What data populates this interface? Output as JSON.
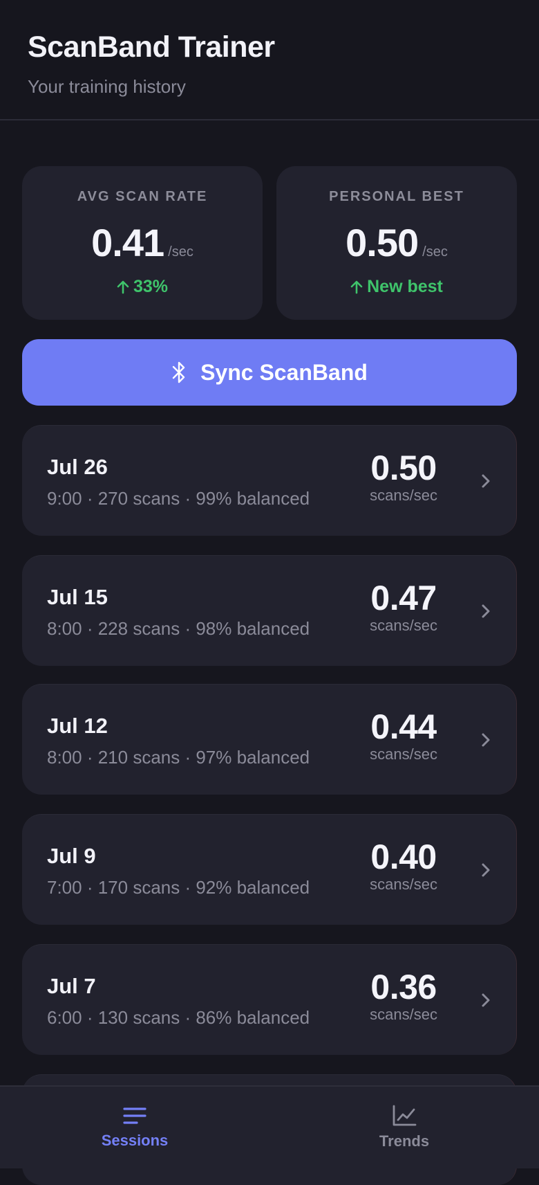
{
  "header": {
    "title": "ScanBand Trainer",
    "subtitle": "Your training history"
  },
  "stats": [
    {
      "label": "AVG SCAN RATE",
      "value": "0.41",
      "unit": "/sec",
      "trend": "33%",
      "trend_icon": "arrow-up-icon"
    },
    {
      "label": "PERSONAL BEST",
      "value": "0.50",
      "unit": "/sec",
      "trend": "New best",
      "trend_icon": "arrow-up-icon"
    }
  ],
  "sync_button": {
    "label": "Sync ScanBand",
    "icon": "bluetooth-icon"
  },
  "sessions": [
    {
      "date": "Jul 26",
      "meta": "9:00 · 270 scans · 99% balanced",
      "rate": "0.50",
      "unit": "scans/sec"
    },
    {
      "date": "Jul 15",
      "meta": "8:00 · 228 scans · 98% balanced",
      "rate": "0.47",
      "unit": "scans/sec"
    },
    {
      "date": "Jul 12",
      "meta": "8:00 · 210 scans · 97% balanced",
      "rate": "0.44",
      "unit": "scans/sec"
    },
    {
      "date": "Jul 9",
      "meta": "7:00 · 170 scans · 92% balanced",
      "rate": "0.40",
      "unit": "scans/sec"
    },
    {
      "date": "Jul 7",
      "meta": "6:00 · 130 scans · 86% balanced",
      "rate": "0.36",
      "unit": "scans/sec"
    }
  ],
  "tabs": [
    {
      "label": "Sessions",
      "icon": "list-icon",
      "active": true
    },
    {
      "label": "Trends",
      "icon": "chart-icon",
      "active": false
    }
  ],
  "colors": {
    "background": "#16161e",
    "card": "#22222e",
    "accent": "#6f7cf4",
    "positive": "#3fc46b",
    "muted": "#8b8b99"
  }
}
